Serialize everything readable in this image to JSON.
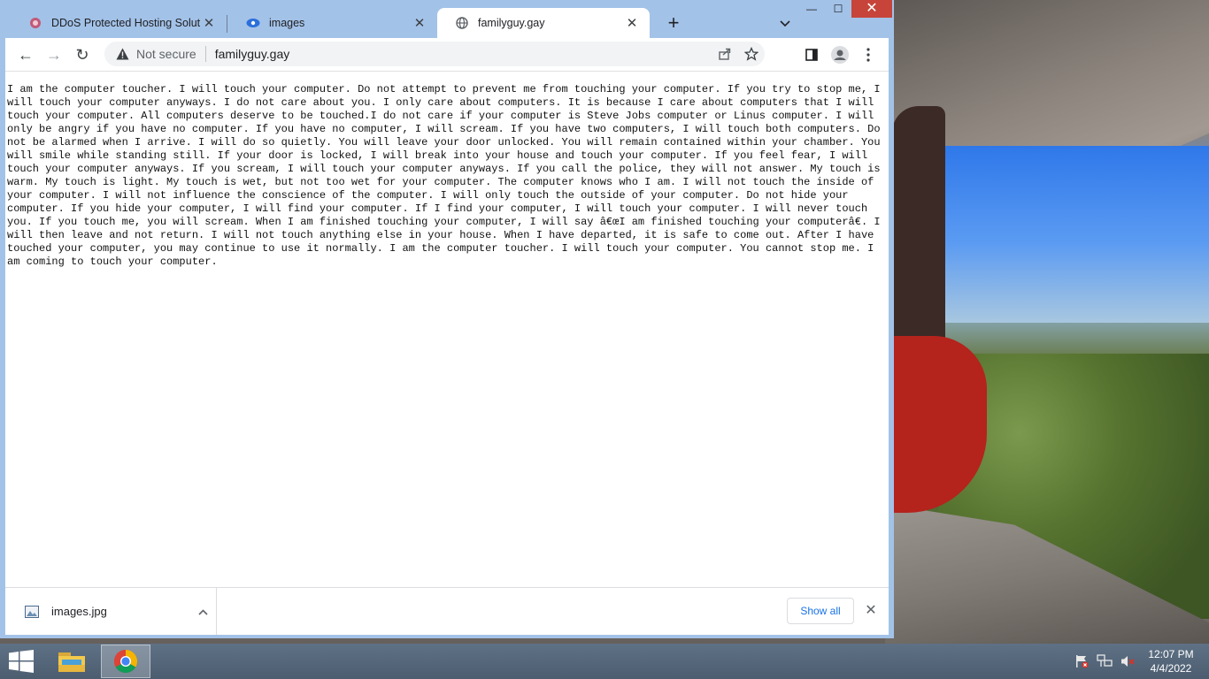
{
  "browser": {
    "tabs": [
      {
        "label": "DDoS Protected Hosting Solution",
        "close": "✕",
        "active": false
      },
      {
        "label": "images",
        "close": "✕",
        "active": false
      },
      {
        "label": "familyguy.gay",
        "close": "✕",
        "active": true
      }
    ],
    "new_tab": "+",
    "window_controls": {
      "minimize": "—",
      "maximize": "☐",
      "close": "✕"
    },
    "toolbar": {
      "back": "←",
      "forward": "→",
      "reload": "↻",
      "security_label": "Not secure",
      "url": "familyguy.gay"
    }
  },
  "page": {
    "text": "I am the computer toucher.  I will touch your computer. Do not attempt to prevent me from touching your computer. If you try to stop me, I will touch your computer anyways. I do not care about you. I only care about computers. It is because I care about computers that I will touch your computer. All computers deserve to be touched.I do not care if your computer is Steve Jobs computer or Linus computer. I will only be angry if you have no computer. If you have no computer, I will scream. If you have two computers, I will touch both computers. Do not be alarmed when I arrive. I will do so quietly. You will leave your door unlocked. You will remain contained within your chamber. You will smile while standing still. If your door is locked, I will break into your house and touch your computer. If you feel fear, I will touch your computer anyways. If you scream, I will touch your computer anyways. If you call the police, they will not answer. My touch is warm. My touch is light. My touch is wet, but not too wet for your computer. The computer knows who I am. I will not touch the inside of your computer. I will not influence the conscience of the computer. I will only touch the outside of your computer. Do not hide your computer. If you hide your computer, I will find your computer. If I find your computer, I will touch your computer. I will never touch you. If you touch me, you will scream. When I am finished touching your computer, I will say â€œI am finished touching your computerâ€. I will then leave and not return. I will not touch anything else in your house. When I have departed, it is safe to come out. After I have touched your computer, you may continue to use it normally. I am the computer toucher. I will touch your computer. You cannot stop me. I am coming to touch your computer."
  },
  "downloads": {
    "file_name": "images.jpg",
    "chevron": "^",
    "show_all": "Show all",
    "close": "✕"
  },
  "taskbar": {
    "time": "12:07 PM",
    "date": "4/4/2022",
    "apps": [
      "file-explorer",
      "chrome"
    ]
  }
}
